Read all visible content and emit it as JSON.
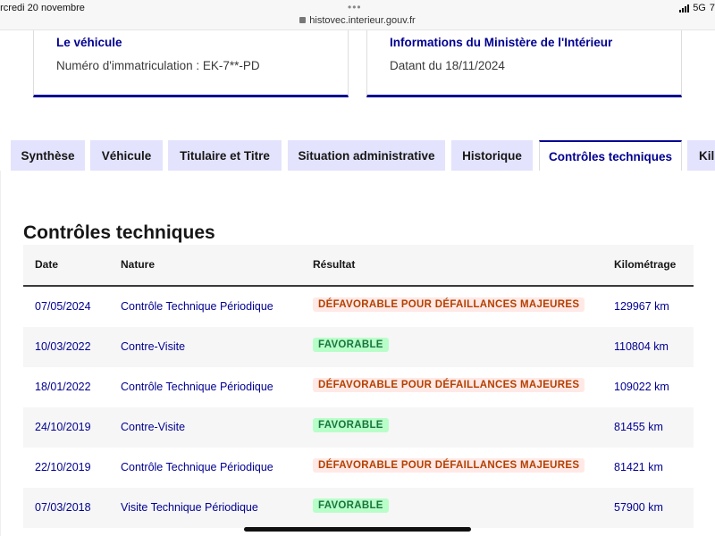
{
  "status_bar": {
    "date": "ercredi 20 novembre",
    "url": "histovec.interieur.gouv.fr",
    "network": "5G",
    "battery_fragment": "7"
  },
  "cards": [
    {
      "title": "Le véhicule",
      "text": "Numéro d'immatriculation : EK-7**-PD"
    },
    {
      "title": "Informations du Ministère de l'Intérieur",
      "text": "Datant du 18/11/2024"
    }
  ],
  "tabs": [
    {
      "label": "Synthèse"
    },
    {
      "label": "Véhicule"
    },
    {
      "label": "Titulaire et Titre"
    },
    {
      "label": "Situation administrative"
    },
    {
      "label": "Historique"
    },
    {
      "label": "Contrôles techniques"
    },
    {
      "label": "Kil"
    }
  ],
  "section": {
    "title": "Contrôles techniques",
    "headers": {
      "date": "Date",
      "nature": "Nature",
      "result": "Résultat",
      "km": "Kilométrage"
    },
    "rows": [
      {
        "date": "07/05/2024",
        "nature": "Contrôle Technique Périodique",
        "result": "DÉFAVORABLE POUR DÉFAILLANCES MAJEURES",
        "status": "bad",
        "km": "129967 km"
      },
      {
        "date": "10/03/2022",
        "nature": "Contre-Visite",
        "result": "FAVORABLE",
        "status": "good",
        "km": "110804 km"
      },
      {
        "date": "18/01/2022",
        "nature": "Contrôle Technique Périodique",
        "result": "DÉFAVORABLE POUR DÉFAILLANCES MAJEURES",
        "status": "bad",
        "km": "109022 km"
      },
      {
        "date": "24/10/2019",
        "nature": "Contre-Visite",
        "result": "FAVORABLE",
        "status": "good",
        "km": "81455 km"
      },
      {
        "date": "22/10/2019",
        "nature": "Contrôle Technique Périodique",
        "result": "DÉFAVORABLE POUR DÉFAILLANCES MAJEURES",
        "status": "bad",
        "km": "81421 km"
      },
      {
        "date": "07/03/2018",
        "nature": "Visite Technique Périodique",
        "result": "FAVORABLE",
        "status": "good",
        "km": "57900 km"
      }
    ]
  },
  "colors": {
    "primary": "#000091",
    "tab_bg": "#e3e3fd",
    "bad_bg": "#ffe9e6",
    "bad_text": "#b34000",
    "good_bg": "#b8fec9",
    "good_text": "#18753c"
  }
}
